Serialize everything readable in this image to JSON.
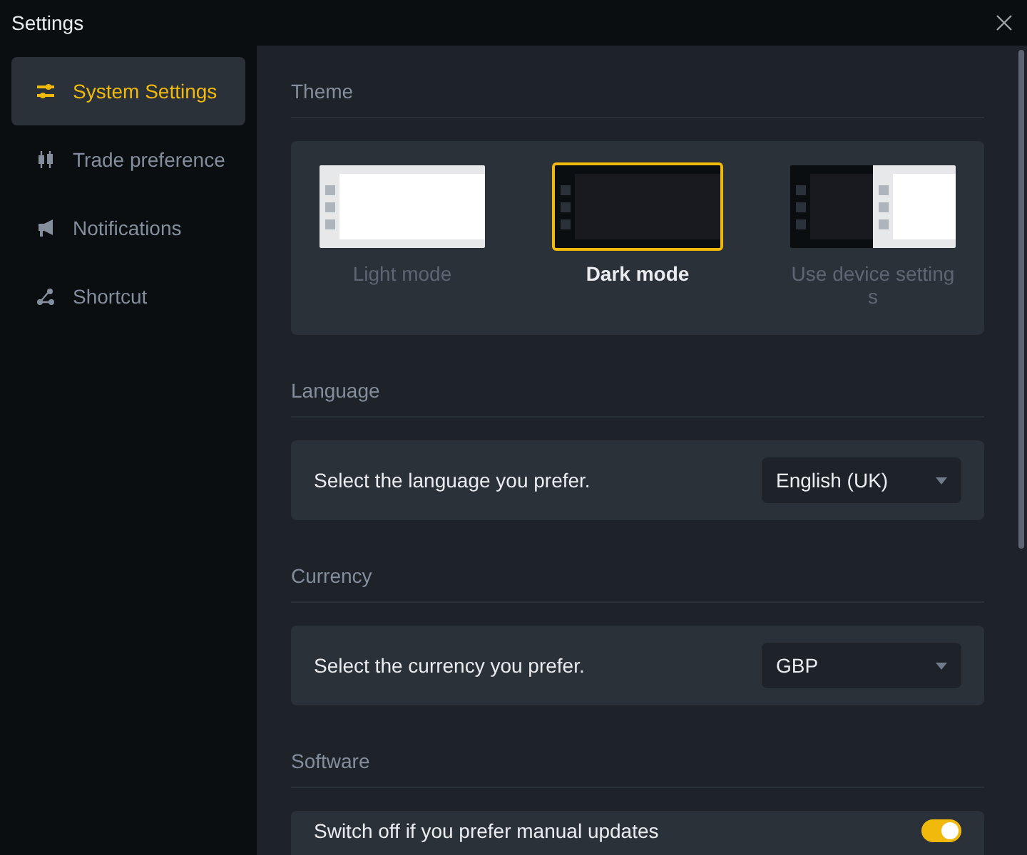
{
  "window": {
    "title": "Settings"
  },
  "sidebar": {
    "items": [
      {
        "label": "System Settings",
        "kind": "sliders",
        "selected": true
      },
      {
        "label": "Trade preference",
        "kind": "candles",
        "selected": false
      },
      {
        "label": "Notifications",
        "kind": "megaphone",
        "selected": false
      },
      {
        "label": "Shortcut",
        "kind": "nodes",
        "selected": false
      }
    ]
  },
  "sections": [
    {
      "title": "Theme",
      "kind": "theme",
      "options": [
        {
          "label": "Light mode",
          "kind": "light",
          "selected": false
        },
        {
          "label": "Dark mode",
          "kind": "dark",
          "selected": true
        },
        {
          "label": "Use device setting s",
          "kind": "split",
          "selected": false
        }
      ]
    },
    {
      "title": "Language",
      "kind": "select",
      "prompt": "Select the language you prefer.",
      "value": "English (UK)"
    },
    {
      "title": "Currency",
      "kind": "select",
      "prompt": "Select the currency you prefer.",
      "value": "GBP"
    },
    {
      "title": "Software",
      "kind": "toggle",
      "prompt": "Switch off if you prefer manual updates",
      "on": true
    }
  ]
}
